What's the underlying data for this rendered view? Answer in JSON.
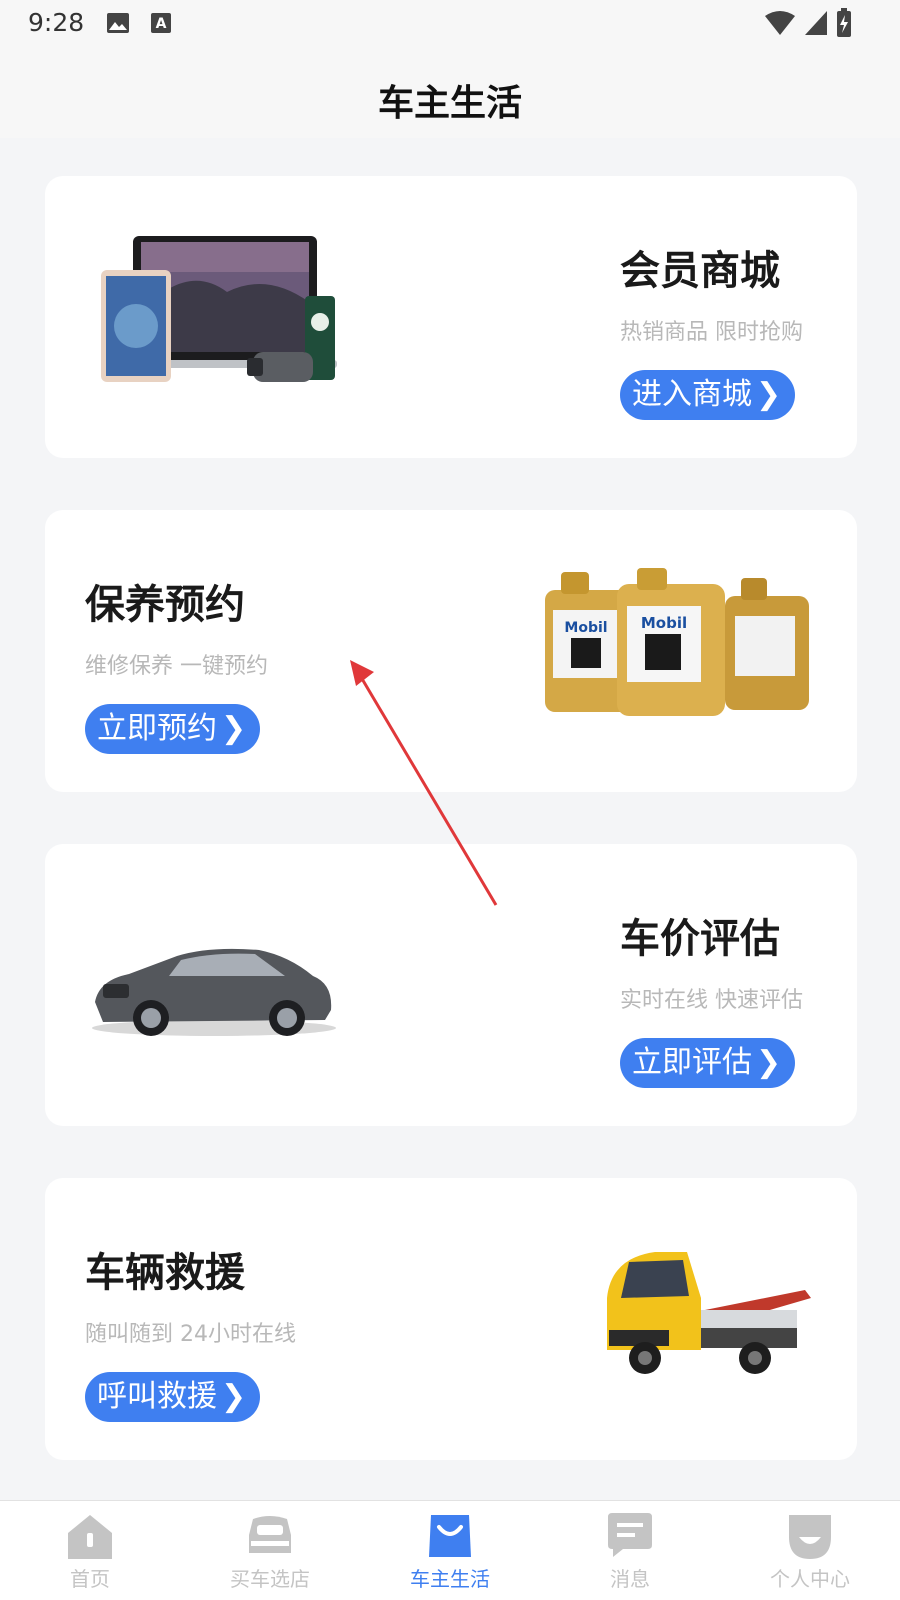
{
  "status_bar": {
    "time": "9:28",
    "icons": [
      "image-icon",
      "text-a-icon",
      "wifi-icon",
      "signal-icon",
      "battery-charging-icon"
    ]
  },
  "header": {
    "title": "车主生活"
  },
  "cards": [
    {
      "title": "会员商城",
      "subtitle": "热销商品 限时抢购",
      "button": "进入商城",
      "chevron": "❯",
      "image": "electronics-products-image"
    },
    {
      "title": "保养预约",
      "subtitle": "维修保养 一键预约",
      "button": "立即预约",
      "chevron": "❯",
      "image": "motor-oil-bottles-image"
    },
    {
      "title": "车价评估",
      "subtitle": "实时在线 快速评估",
      "button": "立即评估",
      "chevron": "❯",
      "image": "sedan-car-image"
    },
    {
      "title": "车辆救援",
      "subtitle": "随叫随到 24小时在线",
      "button": "呼叫救援",
      "chevron": "❯",
      "image": "tow-truck-image"
    }
  ],
  "tabs": [
    {
      "label": "首页",
      "icon": "home-icon",
      "active": false
    },
    {
      "label": "买车选店",
      "icon": "car-icon",
      "active": false
    },
    {
      "label": "车主生活",
      "icon": "shopping-bag-icon",
      "active": true
    },
    {
      "label": "消息",
      "icon": "message-icon",
      "active": false
    },
    {
      "label": "个人中心",
      "icon": "profile-icon",
      "active": false
    }
  ],
  "colors": {
    "accent": "#3f7ff0",
    "inactive_tab": "#c4c4c4",
    "background": "#f4f5f7",
    "annotation_arrow": "#e0383a"
  }
}
